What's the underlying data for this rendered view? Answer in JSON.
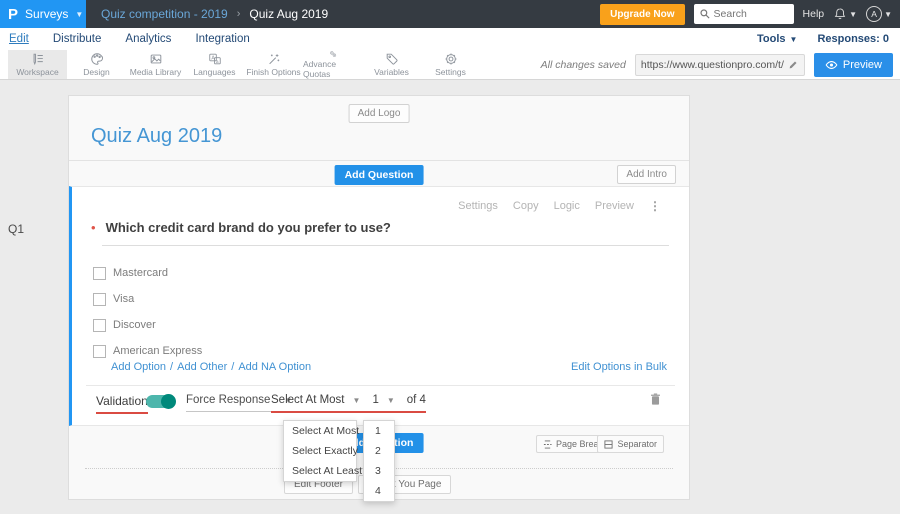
{
  "topbar": {
    "logo_letter": "P",
    "product": "Surveys",
    "breadcrumb": {
      "parent": "Quiz competition - 2019",
      "separator": "›",
      "current": "Quiz Aug 2019"
    },
    "upgrade_label": "Upgrade Now",
    "search_placeholder": "Search",
    "help_label": "Help",
    "avatar_initial": "A"
  },
  "nav": {
    "items": [
      "Edit",
      "Distribute",
      "Analytics",
      "Integration"
    ],
    "tools_label": "Tools",
    "responses_label": "Responses: 0"
  },
  "toolbar": {
    "items": [
      {
        "label": "Workspace"
      },
      {
        "label": "Design"
      },
      {
        "label": "Media Library"
      },
      {
        "label": "Languages"
      },
      {
        "label": "Finish Options"
      },
      {
        "label": "Advance Quotas"
      },
      {
        "label": "Variables"
      },
      {
        "label": "Settings"
      }
    ],
    "saved_status": "All changes saved",
    "survey_url": "https://www.questionpro.com/t/APNrFZ",
    "preview_label": "Preview"
  },
  "survey": {
    "add_logo_label": "Add Logo",
    "title": "Quiz Aug 2019",
    "add_question_label": "Add Question",
    "add_intro_label": "Add Intro",
    "question": {
      "number": "Q1",
      "required_marker": "•",
      "text": "Which credit card brand do you prefer to use?",
      "actions": [
        "Settings",
        "Copy",
        "Logic",
        "Preview"
      ],
      "options": [
        "Mastercard",
        "Visa",
        "Discover",
        "American Express"
      ],
      "option_links": [
        "Add Option",
        "Add Other",
        "Add NA Option"
      ],
      "link_separator": "/",
      "bulk_edit_label": "Edit Options in Bulk",
      "validation": {
        "label": "Validation",
        "force_response_label": "Force Response",
        "rule_value": "Select At Most",
        "count_value": "1",
        "of_total": "of 4"
      }
    },
    "page_break_label": "Page Break",
    "separator_label": "Separator",
    "edit_footer_label": "Edit Footer",
    "thank_you_label": "Thank You Page"
  },
  "dropdowns": {
    "rule_options": [
      "Select At Most",
      "Select Exactly",
      "Select At Least"
    ],
    "count_options": [
      "1",
      "2",
      "3",
      "4"
    ]
  },
  "colors": {
    "brand_blue": "#2196f3",
    "topbar_bg": "#353b42",
    "upgrade_orange": "#f9a11b",
    "toggle_teal": "#00897b",
    "annotation_red": "#da4b42",
    "link_blue": "#4091d2"
  }
}
